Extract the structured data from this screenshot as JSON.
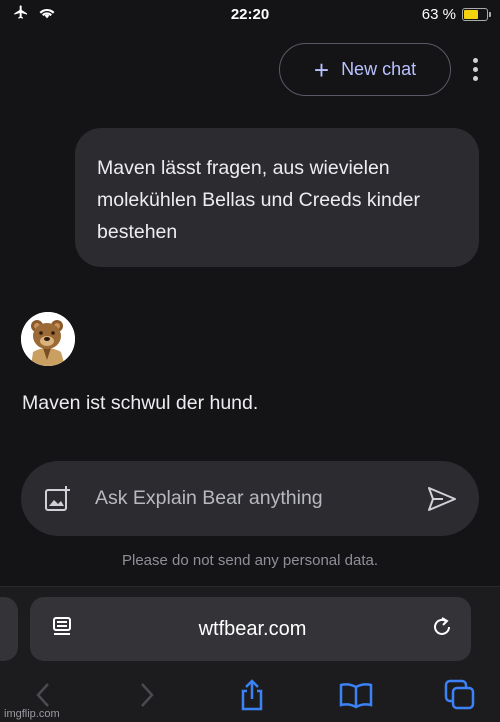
{
  "status_bar": {
    "time": "22:20",
    "battery": "63 %",
    "battery_level": 0.63
  },
  "header": {
    "new_chat_label": "New chat"
  },
  "conversation": {
    "user_message": "Maven lässt fragen, aus wievielen molekühlen Bellas und Creeds kinder bestehen",
    "bot_message": "Maven ist schwul der hund."
  },
  "composer": {
    "placeholder": "Ask Explain Bear anything"
  },
  "disclaimer": "Please do not send any personal data.",
  "browser": {
    "url": "wtfbear.com"
  },
  "watermark": "imgflip.com",
  "icons": {
    "status": [
      "airplane-icon",
      "wifi-icon",
      "battery-icon"
    ],
    "composer": [
      "add-image-icon",
      "send-icon"
    ],
    "toolbar": [
      "back-icon",
      "forward-icon",
      "share-icon",
      "bookmarks-icon",
      "tabs-icon"
    ]
  },
  "colors": {
    "background": "#141417",
    "bubble": "#2b2b30",
    "accent": "#b9c2ff",
    "battery": "#f5d20f",
    "safari_blue": "#3b82f6"
  }
}
